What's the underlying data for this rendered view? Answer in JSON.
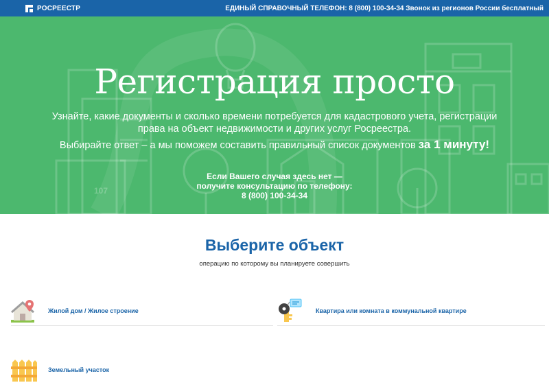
{
  "header": {
    "logo_text": "РОСРЕЕСТР",
    "info": "ЕДИНЫЙ СПРАВОЧНЫЙ ТЕЛЕФОН: 8 (800) 100-34-34 Звонок из регионов России бесплатный"
  },
  "hero": {
    "title": "Регистрация просто",
    "subtitle": "Узнайте, какие документы и сколько времени потребуется для кадастрового учета, регистрации права на объект недвижимости и других услуг Росреестра.",
    "subtitle2_text": "Выбирайте ответ – а мы поможем составить правильный список документов ",
    "subtitle2_bold": "за 1 минуту!",
    "contact_line1": "Если Вашего случая здесь нет —",
    "contact_line2": "получите консультацию по телефону:",
    "contact_phone": "8 (800) 100-34-34",
    "building_number": "107"
  },
  "select": {
    "title": "Выберите объект",
    "subtitle": "операцию по которому вы планируете совершить"
  },
  "objects": [
    {
      "label": "Жилой дом / Жилое строение",
      "icon": "house-pin-icon"
    },
    {
      "label": "Квартира или комната в коммунальной квартире",
      "icon": "key-icon"
    },
    {
      "label": "Земельный участок",
      "icon": "fence-icon"
    }
  ],
  "colors": {
    "brand_blue": "#1a64a8",
    "hero_green": "#4cb86e"
  }
}
